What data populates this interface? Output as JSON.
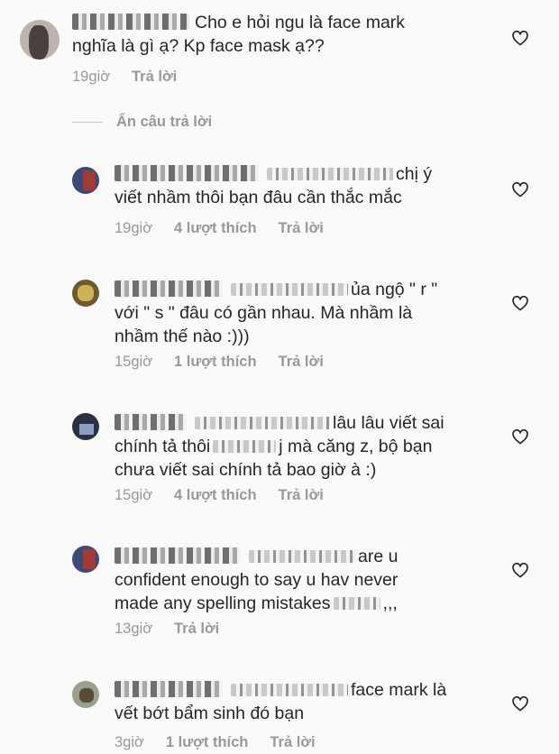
{
  "heart_icon": "heart-outline-icon",
  "comments": [
    {
      "text_lines": [
        "Cho e hỏi ngu là face mark",
        "nghĩa là gì ạ? Kp face mask ạ??"
      ],
      "time": "19giờ",
      "likes": "",
      "reply": "Trả lời"
    },
    {
      "text_lines": [
        "chị ý",
        "viết nhầm thôi bạn đâu cần thắc mắc"
      ],
      "time": "19giờ",
      "likes": "4 lượt thích",
      "reply": "Trả lời"
    },
    {
      "text_lines": [
        "ủa ngộ \" r \"",
        "với \" s \" đâu có gần nhau. Mà nhầm là",
        "nhầm thế nào :)))"
      ],
      "time": "15giờ",
      "likes": "1 lượt thích",
      "reply": "Trả lời"
    },
    {
      "text_lines": [
        "lâu lâu viết sai",
        "chính tả thôi",
        "j mà căng z, bộ bạn",
        "chưa viết sai chính tả bao giờ à :)"
      ],
      "time": "15giờ",
      "likes": "4 lượt thích",
      "reply": "Trả lời"
    },
    {
      "text_lines": [
        "are u",
        "confident enough to say u hav never",
        "made any spelling mistakes",
        ",,,"
      ],
      "time": "13giờ",
      "likes": "",
      "reply": "Trả lời"
    },
    {
      "text_lines": [
        "face mark là",
        "vết bớt bẩm sinh đó bạn"
      ],
      "time": "3giờ",
      "likes": "1 lượt thích",
      "reply": "Trả lời"
    }
  ],
  "hide_replies": "Ẩn câu trả lời"
}
